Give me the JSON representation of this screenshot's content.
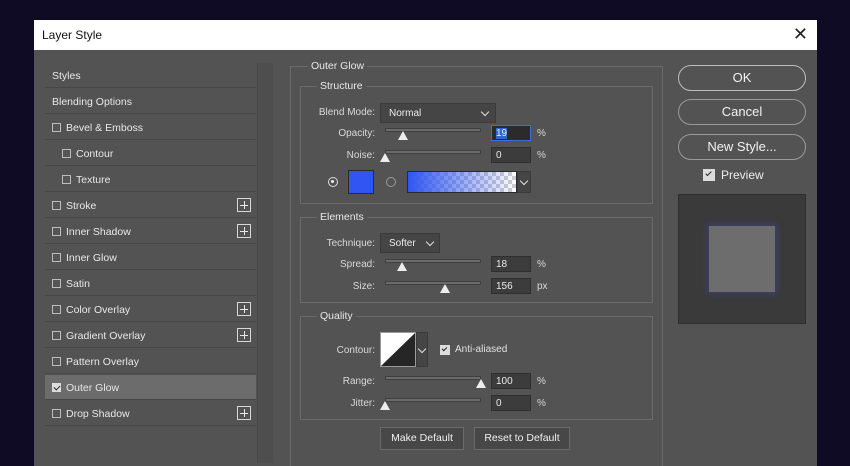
{
  "window": {
    "title": "Layer Style",
    "close_glyph": "✕"
  },
  "styles_list": {
    "items": [
      {
        "label": "Styles",
        "checkbox": false,
        "checked": false,
        "plus": false,
        "indent": 0
      },
      {
        "label": "Blending Options",
        "checkbox": false,
        "checked": false,
        "plus": false,
        "indent": 0
      },
      {
        "label": "Bevel & Emboss",
        "checkbox": true,
        "checked": false,
        "plus": false,
        "indent": 0
      },
      {
        "label": "Contour",
        "checkbox": true,
        "checked": false,
        "plus": false,
        "indent": 1
      },
      {
        "label": "Texture",
        "checkbox": true,
        "checked": false,
        "plus": false,
        "indent": 1
      },
      {
        "label": "Stroke",
        "checkbox": true,
        "checked": false,
        "plus": true,
        "indent": 0
      },
      {
        "label": "Inner Shadow",
        "checkbox": true,
        "checked": false,
        "plus": true,
        "indent": 0
      },
      {
        "label": "Inner Glow",
        "checkbox": true,
        "checked": false,
        "plus": false,
        "indent": 0
      },
      {
        "label": "Satin",
        "checkbox": true,
        "checked": false,
        "plus": false,
        "indent": 0
      },
      {
        "label": "Color Overlay",
        "checkbox": true,
        "checked": false,
        "plus": true,
        "indent": 0
      },
      {
        "label": "Gradient Overlay",
        "checkbox": true,
        "checked": false,
        "plus": true,
        "indent": 0
      },
      {
        "label": "Pattern Overlay",
        "checkbox": true,
        "checked": false,
        "plus": false,
        "indent": 0
      },
      {
        "label": "Outer Glow",
        "checkbox": true,
        "checked": true,
        "plus": false,
        "indent": 0,
        "selected": true
      },
      {
        "label": "Drop Shadow",
        "checkbox": true,
        "checked": false,
        "plus": true,
        "indent": 0
      }
    ]
  },
  "outer_glow": {
    "section_title": "Outer Glow",
    "structure": {
      "title": "Structure",
      "blend_mode_label": "Blend Mode:",
      "blend_mode_value": "Normal",
      "opacity_label": "Opacity:",
      "opacity_value": "19",
      "opacity_unit": "%",
      "opacity_level": 19,
      "noise_label": "Noise:",
      "noise_value": "0",
      "noise_unit": "%",
      "noise_level": 0,
      "glow_color": "#3055f2"
    },
    "elements": {
      "title": "Elements",
      "technique_label": "Technique:",
      "technique_value": "Softer",
      "spread_label": "Spread:",
      "spread_value": "18",
      "spread_unit": "%",
      "spread_level": 18,
      "size_label": "Size:",
      "size_value": "156",
      "size_unit": "px",
      "size_level": 62
    },
    "quality": {
      "title": "Quality",
      "contour_label": "Contour:",
      "anti_aliased_label": "Anti-aliased",
      "anti_aliased_checked": true,
      "range_label": "Range:",
      "range_value": "100",
      "range_unit": "%",
      "range_level": 100,
      "jitter_label": "Jitter:",
      "jitter_value": "0",
      "jitter_unit": "%",
      "jitter_level": 0
    },
    "make_default_label": "Make Default",
    "reset_default_label": "Reset to Default"
  },
  "actions": {
    "ok_label": "OK",
    "cancel_label": "Cancel",
    "new_style_label": "New Style...",
    "preview_label": "Preview",
    "preview_checked": true
  }
}
